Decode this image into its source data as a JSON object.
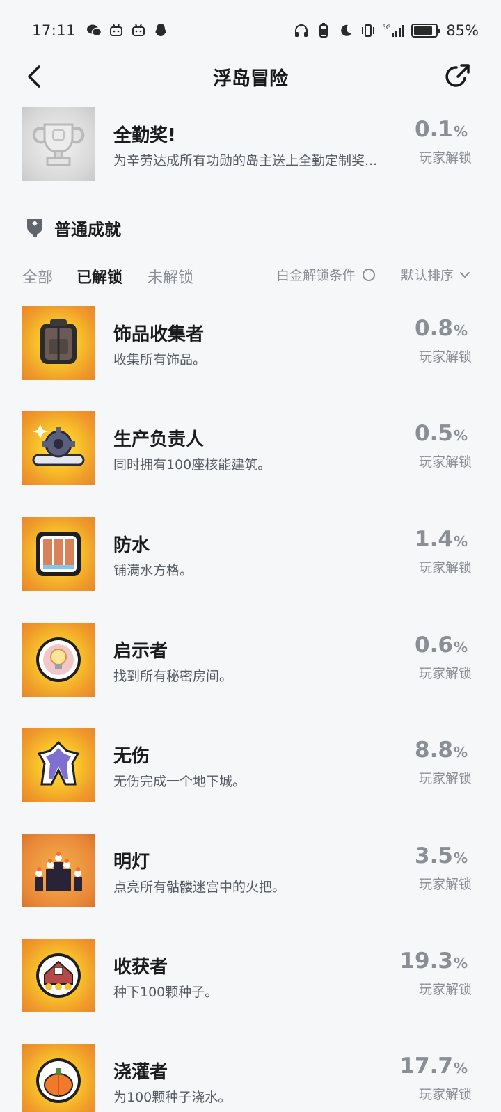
{
  "status_bar": {
    "time": "17:11",
    "battery_percent_label": "85%",
    "battery_level": 0.85,
    "network": "5G"
  },
  "header": {
    "title": "浮岛冒险"
  },
  "top_achievement": {
    "title": "全勤奖!",
    "desc": "为辛劳达成所有功勋的岛主送上全勤定制奖...",
    "pct": "0.1",
    "unit": "%",
    "sub": "玩家解锁"
  },
  "section": {
    "title": "普通成就"
  },
  "filters": {
    "tabs": [
      "全部",
      "已解锁",
      "未解锁"
    ],
    "active_tab": "已解锁",
    "platinum_label": "白金解锁条件",
    "sort_label": "默认排序"
  },
  "achievements": [
    {
      "title": "饰品收集者",
      "desc": "收集所有饰品。",
      "pct": "0.8",
      "unit": "%",
      "sub": "玩家解锁",
      "icon": "backpack-icon"
    },
    {
      "title": "生产负责人",
      "desc": "同时拥有100座核能建筑。",
      "pct": "0.5",
      "unit": "%",
      "sub": "玩家解锁",
      "icon": "gear-wrench-icon"
    },
    {
      "title": "防水",
      "desc": "铺满水方格。",
      "pct": "1.4",
      "unit": "%",
      "sub": "玩家解锁",
      "icon": "wood-planks-icon"
    },
    {
      "title": "启示者",
      "desc": "找到所有秘密房间。",
      "pct": "0.6",
      "unit": "%",
      "sub": "玩家解锁",
      "icon": "lightbulb-icon"
    },
    {
      "title": "无伤",
      "desc": "无伤完成一个地下城。",
      "pct": "8.8",
      "unit": "%",
      "sub": "玩家解锁",
      "icon": "ghost-figure-icon"
    },
    {
      "title": "明灯",
      "desc": "点亮所有骷髅迷宫中的火把。",
      "pct": "3.5",
      "unit": "%",
      "sub": "玩家解锁",
      "icon": "torches-icon"
    },
    {
      "title": "收获者",
      "desc": "种下100颗种子。",
      "pct": "19.3",
      "unit": "%",
      "sub": "玩家解锁",
      "icon": "barn-icon"
    },
    {
      "title": "浇灌者",
      "desc": "为100颗种子浇水。",
      "pct": "17.7",
      "unit": "%",
      "sub": "玩家解锁",
      "icon": "pumpkin-icon"
    }
  ]
}
